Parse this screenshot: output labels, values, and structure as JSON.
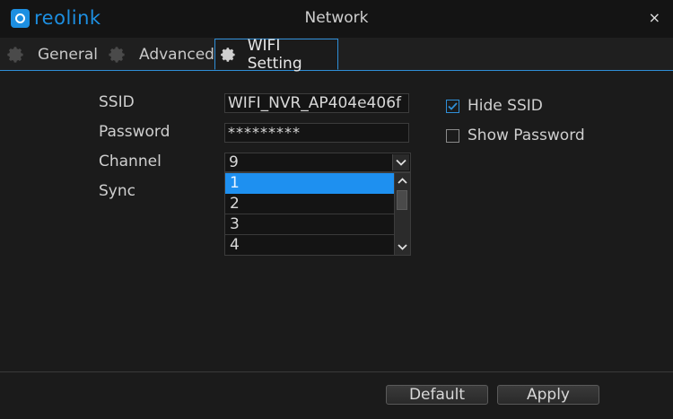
{
  "app": {
    "logo_text": "reolink",
    "window_title": "Network",
    "close_symbol": "×",
    "brand_color": "#1d8fe1"
  },
  "tabs": [
    {
      "label": "General",
      "icon": "gear-icon",
      "active": false
    },
    {
      "label": "Advanced",
      "icon": "gear-icon",
      "active": false
    },
    {
      "label": "WIFI Setting",
      "icon": "gear-icon",
      "active": true
    }
  ],
  "form": {
    "ssid_label": "SSID",
    "ssid_value": "WIFI_NVR_AP404e406f",
    "password_label": "Password",
    "password_value": "*********",
    "channel_label": "Channel",
    "channel_value": "9",
    "sync_label": "Sync",
    "channel_options": [
      "1",
      "2",
      "3",
      "4"
    ],
    "highlighted_option": "1"
  },
  "options": {
    "hide_ssid_label": "Hide SSID",
    "hide_ssid_checked": true,
    "show_password_label": "Show Password",
    "show_password_checked": false
  },
  "footer": {
    "default_label": "Default",
    "apply_label": "Apply"
  }
}
